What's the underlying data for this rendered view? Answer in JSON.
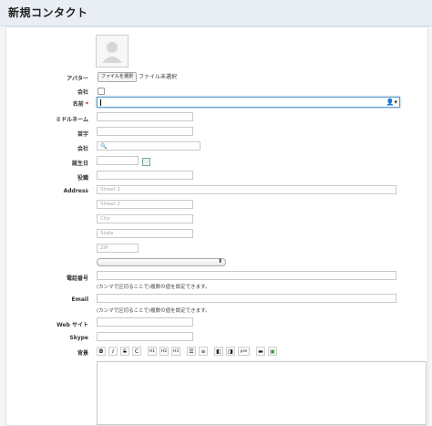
{
  "header": {
    "title": "新規コンタクト"
  },
  "form": {
    "avatar": {
      "label": "アバター",
      "button": "ファイルを選択",
      "status": "ファイル未選択"
    },
    "company_flag": {
      "label": "会社"
    },
    "name": {
      "label": "名前",
      "required_mark": "*",
      "value": ""
    },
    "middle_name": {
      "label": "ミドルネーム",
      "value": ""
    },
    "last_name": {
      "label": "苗字",
      "value": ""
    },
    "company": {
      "label": "会社",
      "value": ""
    },
    "birthday": {
      "label": "誕生日",
      "value": ""
    },
    "title": {
      "label": "役職",
      "value": ""
    },
    "address": {
      "label": "Address",
      "street1_placeholder": "Street 1",
      "street2_placeholder": "Street 2",
      "city_placeholder": "City",
      "state_placeholder": "State",
      "zip_placeholder": "ZIP",
      "country_value": ""
    },
    "phone": {
      "label": "電話番号",
      "hint": "(カンマで区切ることで)複数の値を設定できます。"
    },
    "email": {
      "label": "Email",
      "hint": "(カンマで区切ることで)複数の値を設定できます。"
    },
    "website": {
      "label": "Web サイト"
    },
    "skype": {
      "label": "Skype"
    },
    "background": {
      "label": "背景",
      "toolbar": [
        "B",
        "I",
        "S",
        "C",
        "H1",
        "H2",
        "H3",
        "ul",
        "ol",
        "outdent",
        "indent",
        "pre",
        "image",
        "link"
      ]
    }
  }
}
